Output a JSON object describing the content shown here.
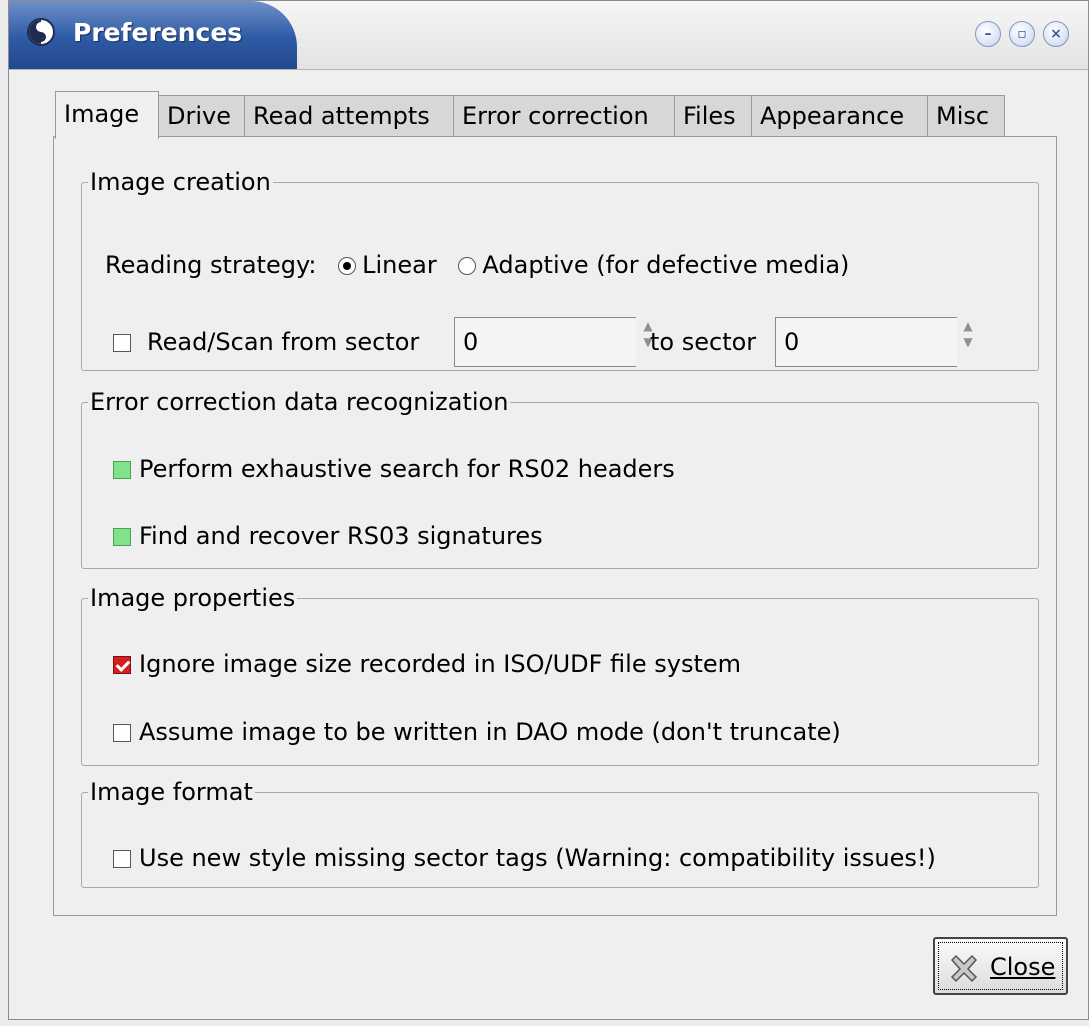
{
  "window": {
    "title": "Preferences"
  },
  "tabs": [
    "Image",
    "Drive",
    "Read attempts",
    "Error correction",
    "Files",
    "Appearance",
    "Misc"
  ],
  "image_creation": {
    "legend": "Image creation",
    "reading_strategy_label": "Reading strategy:",
    "linear_label": "Linear",
    "adaptive_label": "Adaptive (for defective media)",
    "selected_strategy": "Linear",
    "read_scan_label": "Read/Scan from sector",
    "read_scan_checked": false,
    "from_sector_value": "0",
    "to_sector_label": "to sector",
    "to_sector_value": "0"
  },
  "ecc_recognition": {
    "legend": "Error correction data recognization",
    "rs02_label": "Perform exhaustive search for RS02 headers",
    "rs03_label": "Find and recover RS03 signatures"
  },
  "image_properties": {
    "legend": "Image properties",
    "ignore_size_label": "Ignore image size recorded in ISO/UDF file system",
    "ignore_size_checked": true,
    "dao_label": "Assume image to be written in DAO mode (don't truncate)",
    "dao_checked": false
  },
  "image_format": {
    "legend": "Image format",
    "new_tags_label": "Use new style missing sector tags (Warning: compatibility issues!)",
    "new_tags_checked": false
  },
  "close_button": {
    "label": "Close"
  },
  "colors": {
    "title_bar": "#2e5aa5",
    "green_check": "#7ee38b",
    "red_check": "#d61e1e"
  }
}
